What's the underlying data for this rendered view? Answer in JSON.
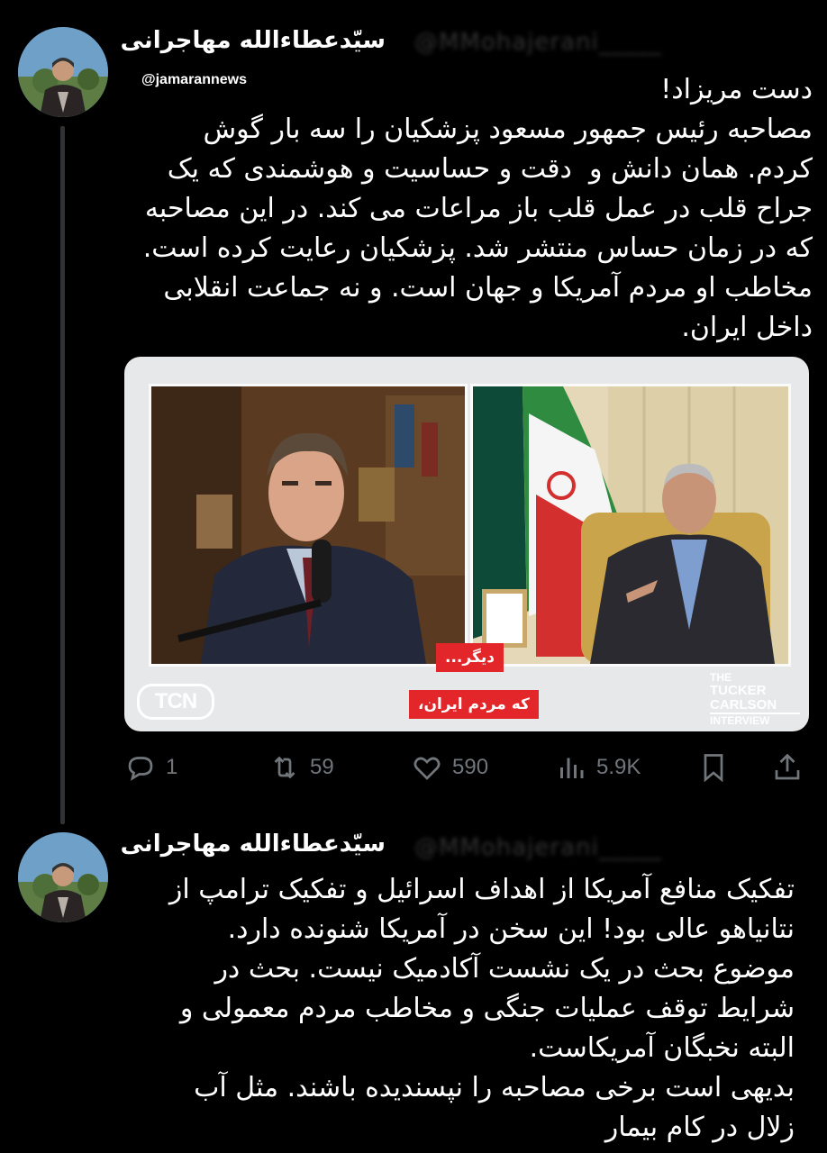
{
  "watermark": "@jamarannews",
  "tweet1": {
    "author_name": "سیّدعطاءالله مهاجرانی",
    "text": "دست مریزاد!\nمصاحبه رئیس جمهور مسعود پزشکیان را سه بار گوش\nکردم. همان دانش و  دقت و حساسیت و هوشمندی که یک\nجراح قلب در عمل قلب باز مراعات می کند. در این مصاحبه\nکه در زمان حساس منتشر شد. پزشکیان رعایت کرده است.\nمخاطب او مردم آمریکا و جهان است. و نه جماعت انقلابی\nداخل ایران.",
    "media": {
      "caption_line1": "دیگر...",
      "caption_line2": "که مردم ایران،",
      "logo_left": "TCN",
      "logo_right_line1": "THE",
      "logo_right_line2": "TUCKER\nCARLSON",
      "logo_right_line3": "INTERVIEW"
    },
    "actions": {
      "replies": "1",
      "reposts": "59",
      "likes": "590",
      "views": "5.9K"
    }
  },
  "tweet2": {
    "author_name": "سیّدعطاءالله مهاجرانی",
    "text": "تفکیک منافع آمریکا از اهداف اسرائیل و تفکیک ترامپ از\nنتانیاهو عالی بود! این سخن در آمریکا شنونده دارد.\nموضوع بحث در یک نشست آکادمیک نیست. بحث در\nشرایط توقف عملیات جنگی و مخاطب مردم معمولی و\nالبته نخبگان آمریکاست.\nبدیهی است برخی مصاحبه را نپسندیده باشند. مثل آب\nزلال در کام بیمار"
  },
  "colors": {
    "background": "#000000",
    "text": "#ffffff",
    "muted": "#71767b",
    "caption_red": "#e3262a"
  }
}
